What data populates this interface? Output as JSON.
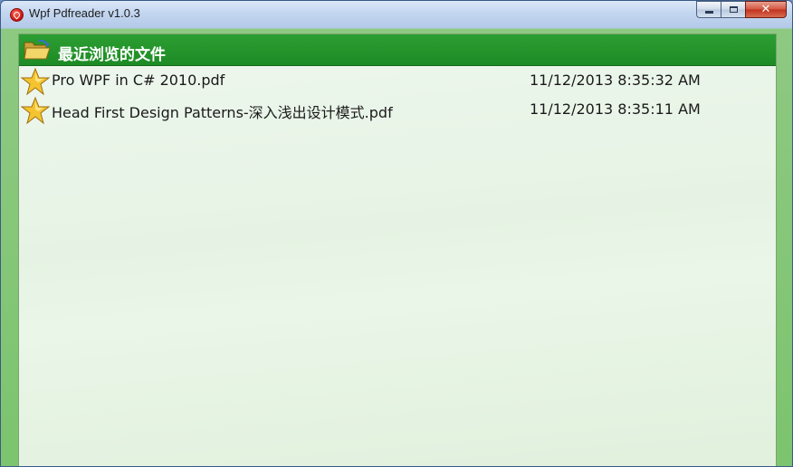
{
  "window": {
    "title": "Wpf Pdfreader v1.0.3",
    "controls": {
      "minimize": "",
      "maximize": "",
      "close": "✕"
    }
  },
  "panel": {
    "header_title": "最近浏览的文件",
    "icon": "folder-open-icon",
    "files": [
      {
        "name": "Pro WPF in C# 2010.pdf",
        "date": "11/12/2013 8:35:32 AM",
        "icon": "star-icon"
      },
      {
        "name": "Head First Design Patterns-深入浅出设计模式.pdf",
        "date": "11/12/2013 8:35:11 AM",
        "icon": "star-icon"
      }
    ]
  },
  "colors": {
    "header_green": "#1e8b25",
    "frame_green": "#7cc46e",
    "titlebar_blue": "#c3d6f0",
    "close_red": "#c0321e"
  }
}
